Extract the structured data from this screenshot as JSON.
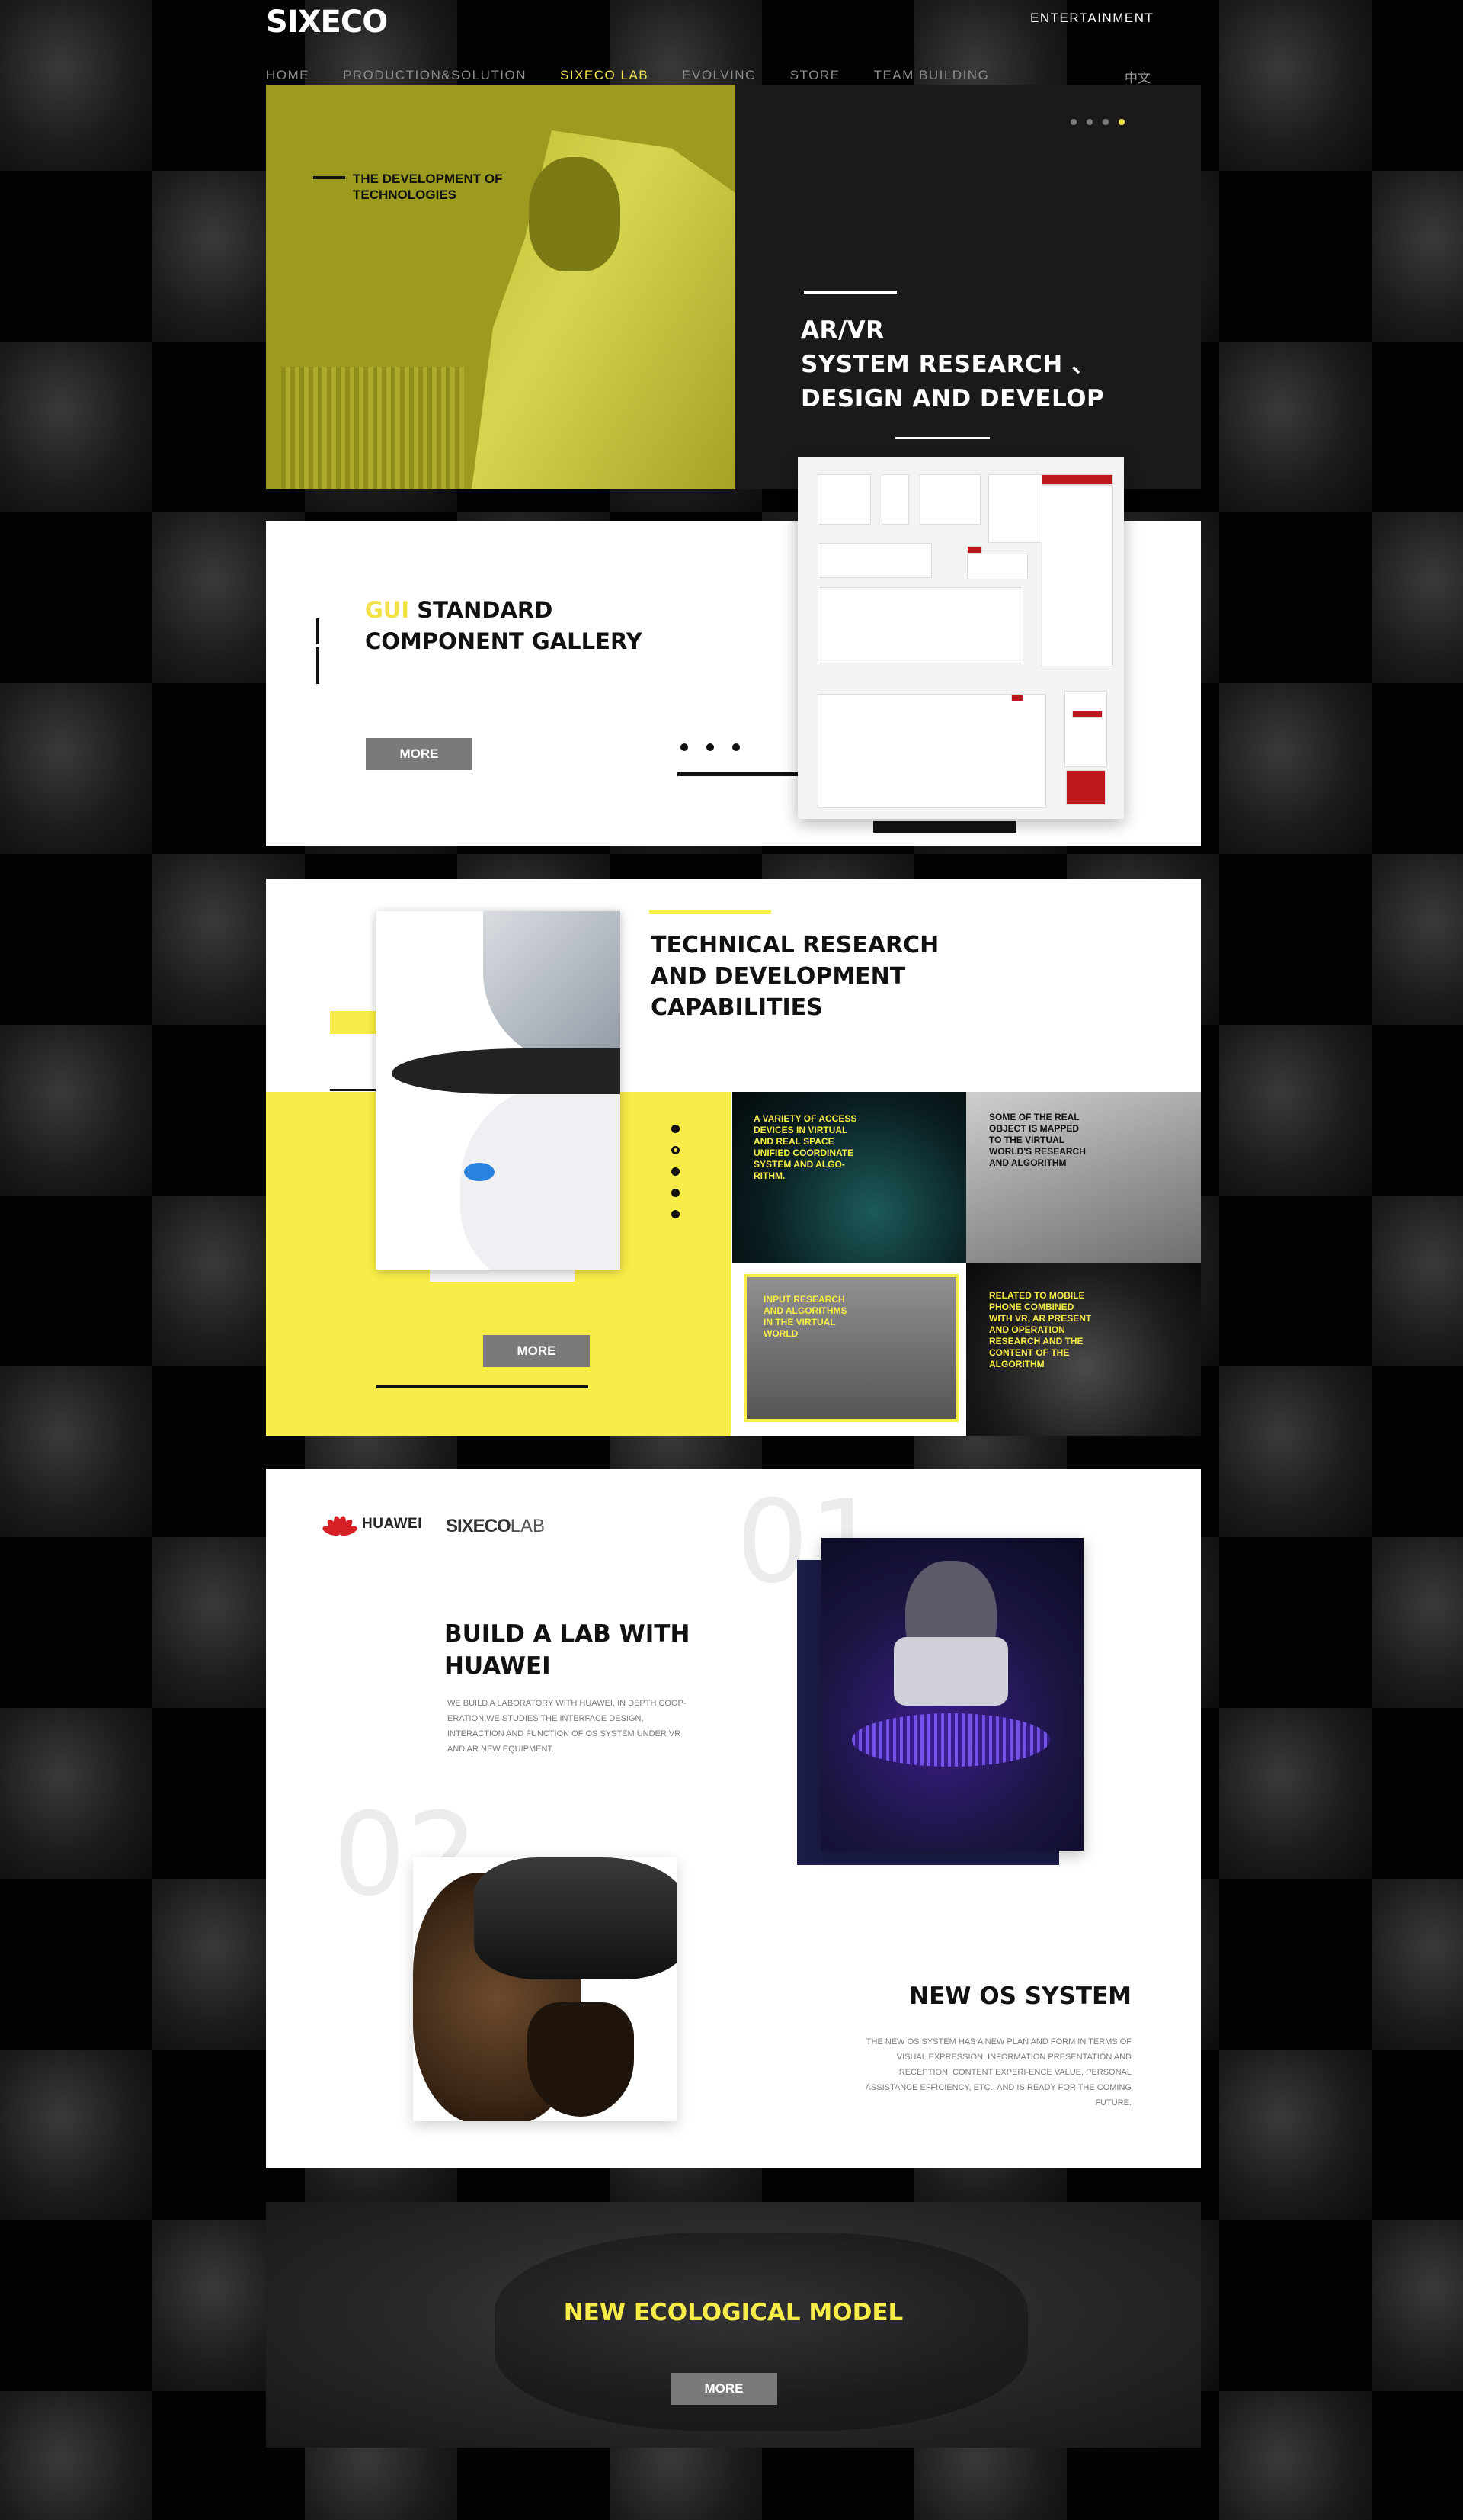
{
  "header": {
    "logo": "SIXECO",
    "entertainment": "ENTERTAINMENT",
    "lang": "中文",
    "nav": [
      "HOME",
      "PRODUCTION&SOLUTION",
      "SIXECO LAB",
      "EVOLVING",
      "STORE",
      "TEAM BUILDING"
    ],
    "active_nav": "SIXECO LAB"
  },
  "hero": {
    "tag": "THE DEVELOPMENT OF TECHNOLOGIES",
    "title": "AR/VR\nSYSTEM RESEARCH 、\nDESIGN AND DEVELOP",
    "slide_count": 4,
    "active_slide": 4
  },
  "gui": {
    "title_highlight": "GUI",
    "title_rest_1": "STANDARD",
    "title_line_2": "COMPONENT GALLERY",
    "more": "MORE"
  },
  "tech": {
    "title": "TECHNICAL RESEARCH AND DEVELOPMENT CAPABILITIES",
    "more": "MORE",
    "tiles": [
      "A VARIETY OF ACCESS DEVICES IN VIRTUAL AND REAL SPACE UNIFIED COORDINATE SYSTEM AND ALGO-RITHM.",
      "SOME OF THE REAL OBJECT IS MAPPED TO THE VIRTUAL WORLD'S RESEARCH AND ALGORITHM",
      "INPUT RESEARCH AND ALGORITHMS IN THE VIRTUAL WORLD",
      "RELATED TO MOBILE PHONE COMBINED WITH VR, AR PRESENT AND OPERATION RESEARCH AND THE CONTENT OF THE ALGORITHM"
    ]
  },
  "huawei": {
    "partner_logo": "HUAWEI",
    "lab_logo_bold": "SIXECO",
    "lab_logo_light": "LAB",
    "num1": "01",
    "num2": "02",
    "title": "BUILD A LAB WITH HUAWEI",
    "desc": "WE BUILD A LABORATORY WITH HUAWEI, IN DEPTH COOP-ERATION,WE STUDIES THE INTERFACE DESIGN, INTERACTION AND FUNCTION OF OS SYSTEM UNDER VR AND AR NEW EQUIPMENT.",
    "os_title": "NEW OS SYSTEM",
    "os_desc": "THE NEW OS SYSTEM HAS A NEW PLAN AND FORM IN TERMS OF VISUAL EXPRESSION, INFORMATION PRESENTATION AND RECEPTION, CONTENT EXPERI-ENCE VALUE, PERSONAL ASSISTANCE EFFICIENCY, ETC., AND IS READY FOR THE COMING FUTURE."
  },
  "eco": {
    "title": "NEW ECOLOGICAL MODEL",
    "more": "MORE"
  },
  "colors": {
    "accent_yellow": "#f7ec48",
    "brand_red": "#d71f26",
    "button_gray": "#7a7a7a"
  }
}
